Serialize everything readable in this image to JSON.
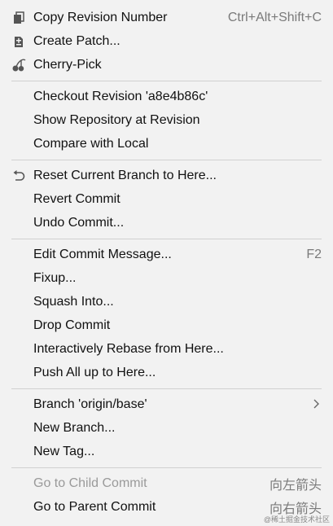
{
  "menu": {
    "group1": [
      {
        "label": "Copy Revision Number",
        "shortcut": "Ctrl+Alt+Shift+C",
        "icon": "copy-icon"
      },
      {
        "label": "Create Patch...",
        "shortcut": "",
        "icon": "patch-icon"
      },
      {
        "label": "Cherry-Pick",
        "shortcut": "",
        "icon": "cherry-icon"
      }
    ],
    "group2": [
      {
        "label": "Checkout Revision 'a8e4b86c'"
      },
      {
        "label": "Show Repository at Revision"
      },
      {
        "label": "Compare with Local"
      }
    ],
    "group3": [
      {
        "label": "Reset Current Branch to Here...",
        "icon": "undo-arrow-icon"
      },
      {
        "label": "Revert Commit"
      },
      {
        "label": "Undo Commit..."
      }
    ],
    "group4": [
      {
        "label": "Edit Commit Message...",
        "shortcut": "F2"
      },
      {
        "label": "Fixup..."
      },
      {
        "label": "Squash Into..."
      },
      {
        "label": "Drop Commit"
      },
      {
        "label": "Interactively Rebase from Here..."
      },
      {
        "label": "Push All up to Here..."
      }
    ],
    "group5": [
      {
        "label": "Branch 'origin/base'",
        "icon": "chevron-right-icon"
      },
      {
        "label": "New Branch..."
      },
      {
        "label": "New Tag..."
      }
    ],
    "group6": [
      {
        "label": "Go to Child Commit",
        "shortcut": "向左箭头"
      },
      {
        "label": "Go to Parent Commit",
        "shortcut": "向右箭头"
      }
    ]
  },
  "watermark": "@稀土掘金技术社区"
}
